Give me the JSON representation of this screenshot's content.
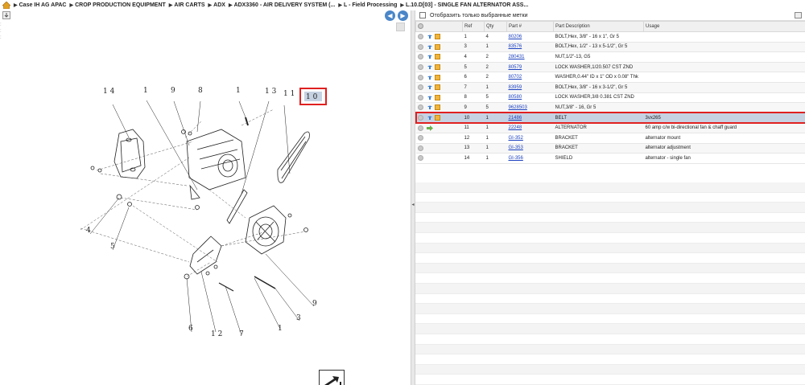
{
  "breadcrumb": [
    "Case IH AG APAC",
    "CROP PRODUCTION EQUIPMENT",
    "AIR CARTS",
    "ADX",
    "ADX3360 - AIR DELIVERY SYSTEM (...",
    "L - Field Processing",
    "L.10.D[03] - SINGLE FAN ALTERNATOR ASS..."
  ],
  "filter": {
    "label": "Отобразить только выбранные метки"
  },
  "table": {
    "columns": [
      "Ref",
      "Qty",
      "Part #",
      "Part Description",
      "Usage"
    ],
    "rows": [
      {
        "ref": "1",
        "qty": "4",
        "part": "80206",
        "desc": "BOLT,Hex, 3/8\" - 16  x 1\", Gr 5",
        "usage": ""
      },
      {
        "ref": "3",
        "qty": "1",
        "part": "83576",
        "desc": "BOLT,Hex, 1/2\" - 13 x 5-1/2\", Gr 5",
        "usage": ""
      },
      {
        "ref": "4",
        "qty": "2",
        "part": "280431",
        "desc": "NUT,1/2\"-13, G5",
        "usage": ""
      },
      {
        "ref": "5",
        "qty": "2",
        "part": "80579",
        "desc": "LOCK WASHER,1/20.507 CST ZND",
        "usage": ""
      },
      {
        "ref": "6",
        "qty": "2",
        "part": "80702",
        "desc": "WASHER,0.44\" ID x 1\" OD x 0.08\" Thk",
        "usage": ""
      },
      {
        "ref": "7",
        "qty": "1",
        "part": "83959",
        "desc": "BOLT,Hex, 3/8\" - 16 x 3-1/2\", Gr 5",
        "usage": ""
      },
      {
        "ref": "8",
        "qty": "5",
        "part": "80580",
        "desc": "LOCK WASHER,3/8 0.381 CST ZND",
        "usage": ""
      },
      {
        "ref": "9",
        "qty": "5",
        "part": "9628503",
        "desc": "NUT,3/8\" - 16, Gr 5",
        "usage": ""
      },
      {
        "ref": "10",
        "qty": "1",
        "part": "21486",
        "desc": "BELT",
        "usage": "3vx265"
      },
      {
        "ref": "11",
        "qty": "1",
        "part": "22248",
        "desc": "ALTERNATOR",
        "usage": "60 amp c/w bi-directional fan & chaff guard"
      },
      {
        "ref": "12",
        "qty": "1",
        "part": "GI-352",
        "desc": "BRACKET",
        "usage": "alternator mount"
      },
      {
        "ref": "13",
        "qty": "1",
        "part": "GI-353",
        "desc": "BRACKET",
        "usage": "alternator adjustment"
      },
      {
        "ref": "14",
        "qty": "1",
        "part": "GI-356",
        "desc": "SHIELD",
        "usage": "alternator - single fan"
      }
    ],
    "selected_ref": "10"
  },
  "diagram": {
    "callouts": [
      "14",
      "1",
      "9",
      "8",
      "1",
      "13",
      "11",
      "10",
      "4",
      "5",
      "6",
      "12",
      "7",
      "1",
      "3",
      "9"
    ],
    "highlighted_callout": "10"
  },
  "colors": {
    "highlight": "#e02020",
    "link": "#1a3fbf",
    "nav": "#4a86c8",
    "selected_row": "#c6d2e2"
  }
}
